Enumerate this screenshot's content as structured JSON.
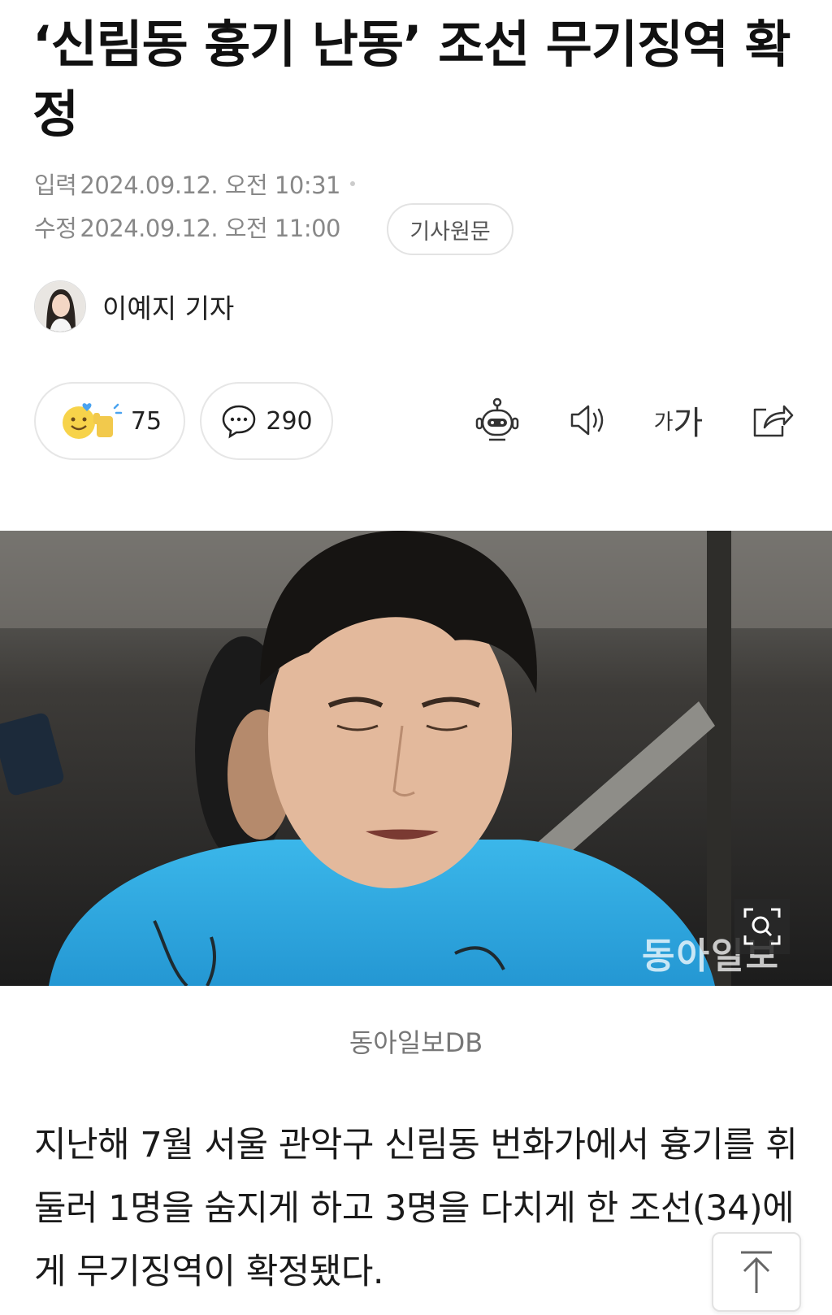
{
  "article": {
    "headline": "‘신림동 흉기 난동’ 조선 무기징역 확정",
    "input_label": "입력",
    "input_time": "2024.09.12. 오전 10:31",
    "edit_label": "수정",
    "edit_time": "2024.09.12. 오전 11:00",
    "original_link": "기사원문",
    "reporter": "이예지 기자"
  },
  "actions": {
    "reaction_count": "75",
    "comment_count": "290",
    "summary_icon": "robot-icon",
    "tts_icon": "speaker-icon",
    "font_label_small": "가",
    "font_label_large": "가",
    "share_icon": "share-icon"
  },
  "photo": {
    "watermark": "동아일보",
    "caption": "동아일보DB",
    "zoom_icon": "zoom-icon"
  },
  "body": {
    "paragraph": "지난해 7월 서울 관악구 신림동 번화가에서 흉기를 휘둘러 1명을 숨지게 하고 3명을 다치게 한 조선(34)에게 무기징역이 확정됐다."
  },
  "colors": {
    "accent_blue": "#2ea8e6",
    "meta_gray": "#888888",
    "border": "#e6e6e6"
  }
}
